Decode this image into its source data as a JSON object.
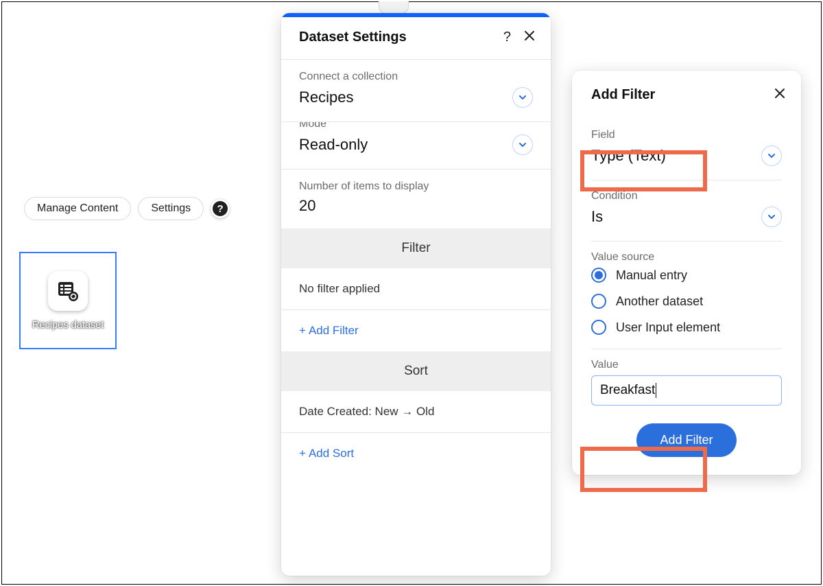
{
  "toolbar": {
    "manage_content": "Manage Content",
    "settings": "Settings",
    "help_symbol": "?"
  },
  "tile": {
    "label": "Recipes dataset"
  },
  "settings_panel": {
    "title": "Dataset Settings",
    "connect_label": "Connect a collection",
    "connect_value": "Recipes",
    "mode_label": "Mode",
    "mode_value": "Read-only",
    "items_label": "Number of items to display",
    "items_value": "20",
    "filter_header": "Filter",
    "filter_status": "No filter applied",
    "add_filter": "Add Filter",
    "sort_header": "Sort",
    "sort_status": "Date Created: New → Old",
    "add_sort": "Add Sort"
  },
  "filter_panel": {
    "title": "Add Filter",
    "field_label": "Field",
    "field_value": "Type (Text)",
    "condition_label": "Condition",
    "condition_value": "Is",
    "value_source_label": "Value source",
    "value_source_options": {
      "manual": "Manual entry",
      "dataset": "Another dataset",
      "input": "User Input element"
    },
    "value_label": "Value",
    "value_input": "Breakfast",
    "submit": "Add Filter"
  },
  "colors": {
    "accent": "#2b6fdc",
    "highlight": "#ee6a4a"
  }
}
